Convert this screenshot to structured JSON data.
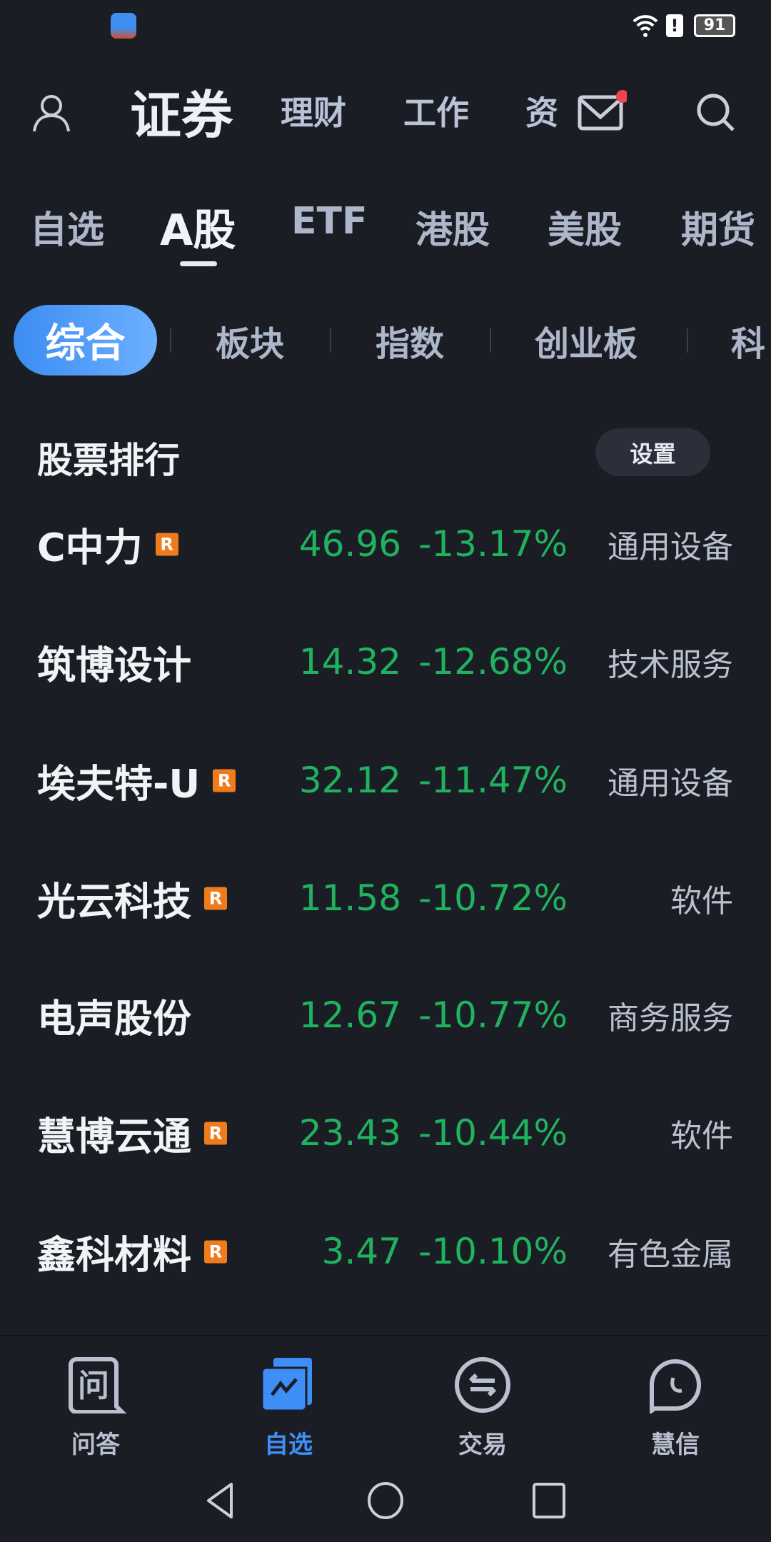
{
  "status_bar": {
    "battery": "91"
  },
  "top_nav": {
    "items": [
      "证券",
      "理财",
      "工作",
      "资"
    ],
    "active": "证券"
  },
  "market_tabs": {
    "items": [
      "自选",
      "A股",
      "ETF",
      "港股",
      "美股",
      "期货"
    ],
    "active": "A股"
  },
  "sub_tabs": {
    "items": [
      "综合",
      "板块",
      "指数",
      "创业板",
      "科"
    ],
    "active": "综合"
  },
  "section": {
    "title": "股票排行",
    "settings_label": "设置"
  },
  "rank_rows": [
    {
      "name": "C中力",
      "badge": "R",
      "price": "46.96",
      "change": "-13.17%",
      "industry": "通用设备"
    },
    {
      "name": "筑博设计",
      "badge": "",
      "price": "14.32",
      "change": "-12.68%",
      "industry": "技术服务"
    },
    {
      "name": "埃夫特-U",
      "badge": "R",
      "price": "32.12",
      "change": "-11.47%",
      "industry": "通用设备"
    },
    {
      "name": "光云科技",
      "badge": "R",
      "price": "11.58",
      "change": "-10.72%",
      "industry": "软件"
    },
    {
      "name": "电声股份",
      "badge": "",
      "price": "12.67",
      "change": "-10.77%",
      "industry": "商务服务"
    },
    {
      "name": "慧博云通",
      "badge": "R",
      "price": "23.43",
      "change": "-10.44%",
      "industry": "软件"
    },
    {
      "name": "鑫科材料",
      "badge": "R",
      "price": "3.47",
      "change": "-10.10%",
      "industry": "有色金属"
    }
  ],
  "bottom_nav": {
    "items": [
      "问答",
      "自选",
      "交易",
      "慧信"
    ],
    "active": "自选"
  },
  "colors": {
    "background": "#1b1d25",
    "down": "#1fb35f",
    "accent": "#3d8ef5",
    "badge": "#f07b1a",
    "notification": "#f0454f"
  }
}
